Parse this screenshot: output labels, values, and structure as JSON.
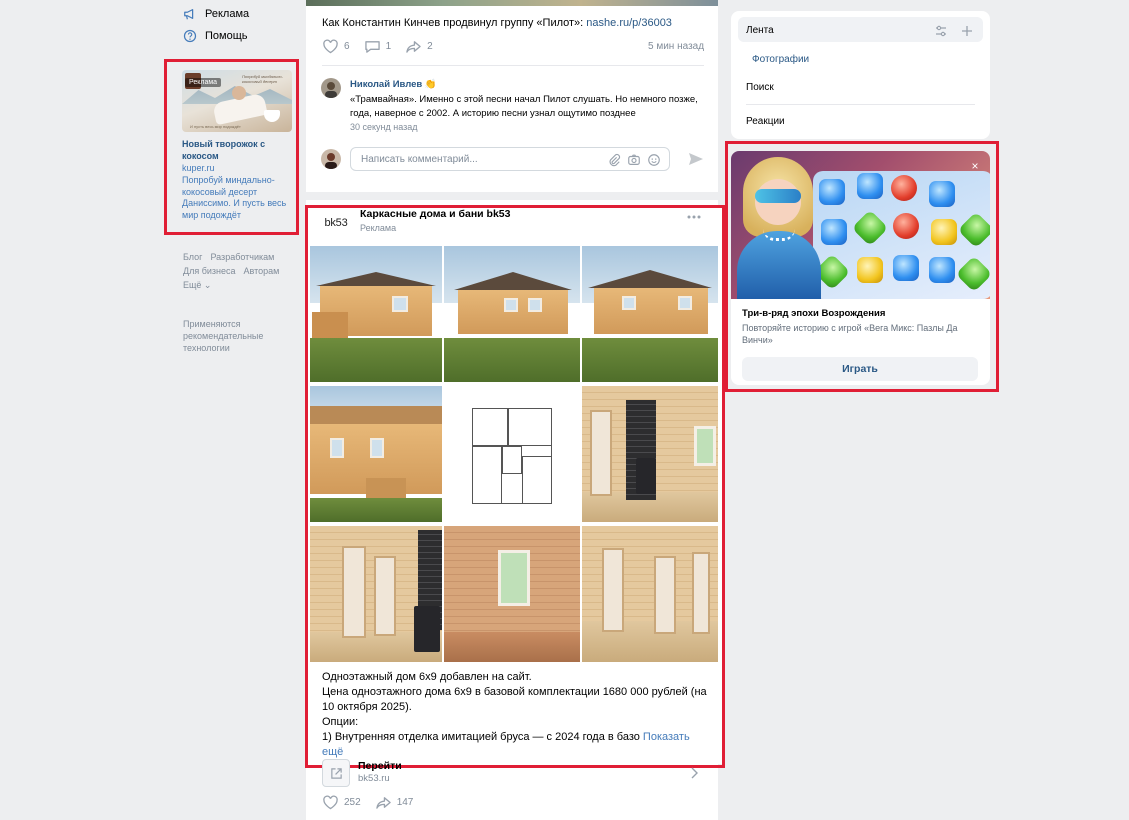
{
  "left_nav": {
    "items": [
      {
        "label": "Реклама",
        "icon": "megaphone-icon"
      },
      {
        "label": "Помощь",
        "icon": "help-icon"
      }
    ],
    "ad": {
      "badge": "Реклама",
      "image_slogan": "Попробуй миндально-кокосовый десерт",
      "image_tagline": "И пусть весь мир подождёт",
      "title": "Новый творожок с кокосом",
      "domain": "kuper.ru",
      "description": "Попробуй миндально-кокосовый десерт Даниссимо. И пусть весь мир подождёт"
    },
    "footer_links": [
      "Блог",
      "Разработчикам",
      "Для бизнеса",
      "Авторам",
      "Ещё ⌄"
    ],
    "footer_note": "Применяются рекомендательные технологии"
  },
  "feed": {
    "post1": {
      "text": "Как Константин Кинчев продвинул группу «Пилот»: ",
      "link": "nashe.ru/p/36003",
      "likes": "6",
      "comments": "1",
      "shares": "2",
      "time": "5 мин назад"
    },
    "comment": {
      "author": "Николай Ивлев 👏",
      "text": "«Трамвайная». Именно с этой песни начал Пилот слушать. Но немного позже, года, наверное с 2002. А историю песни узнал ощутимо позднее",
      "time": "30 секунд назад"
    },
    "comment_input": {
      "placeholder": "Написать комментарий..."
    },
    "ad_post": {
      "logo_text": "bk53",
      "name": "Каркасные дома и бани bk53",
      "subtitle": "Реклама",
      "body_line1": "Одноэтажный дом 6х9 добавлен на сайт.",
      "body_line2": "Цена одноэтажного дома 6х9 в базовой комплектации 1680 000 рублей (на 10 октября 2025).",
      "body_line3": "Опции:",
      "body_line4": "1) Внутренняя отделка имитацией бруса — с 2024 года в базо",
      "show_more": "Показать ещё",
      "link_label": "Перейти",
      "link_url": "bk53.ru",
      "likes": "252",
      "shares": "147"
    }
  },
  "right_menu": {
    "items": [
      "Лента",
      "Фотографии",
      "Поиск",
      "Реакции"
    ]
  },
  "game_ad": {
    "title": "Три-в-ряд эпохи Возрождения",
    "description": "Повторяйте историю с игрой «Вега Микс: Пазлы Да Винчи»",
    "button": "Играть",
    "close": "×"
  },
  "colors": {
    "highlight": "#e01e35",
    "link": "#2a5885",
    "muted": "#818c99",
    "background": "#edeef0"
  }
}
